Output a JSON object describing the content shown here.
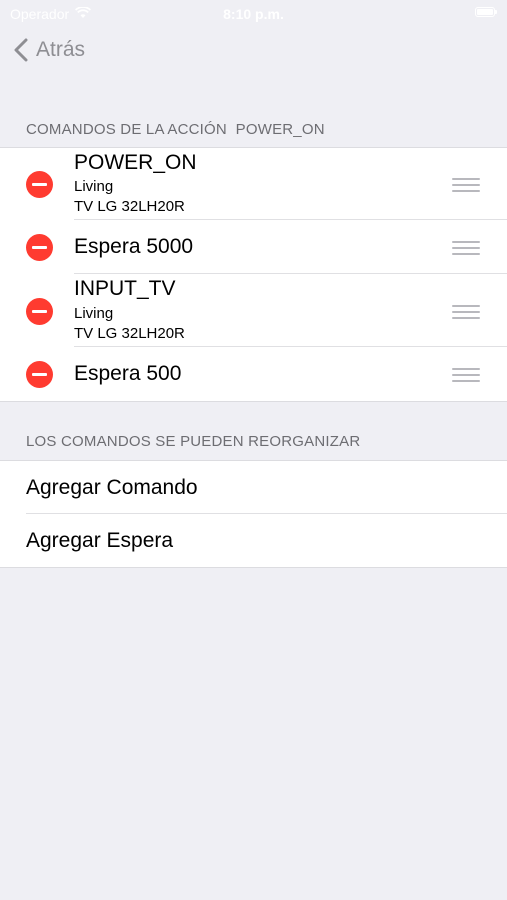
{
  "status_bar": {
    "carrier": "Operador",
    "time": "8:10 p.m."
  },
  "nav": {
    "back_label": "Atrás"
  },
  "sections": {
    "commands_header": "COMANDOS DE LA ACCIÓN  POWER_ON",
    "reorder_header": "LOS COMANDOS SE PUEDEN REORGANIZAR"
  },
  "commands": [
    {
      "title": "POWER_ON",
      "room": "Living",
      "device": "TV LG 32LH20R"
    },
    {
      "title": "Espera 5000"
    },
    {
      "title": "INPUT_TV",
      "room": "Living",
      "device": "TV LG 32LH20R"
    },
    {
      "title": "Espera 500"
    }
  ],
  "actions": {
    "add_command": "Agregar Comando",
    "add_wait": "Agregar Espera"
  },
  "colors": {
    "delete_red": "#ff3b30",
    "background": "#efeff4",
    "section_text": "#6d6d72",
    "nav_gray": "#8e8e93"
  }
}
